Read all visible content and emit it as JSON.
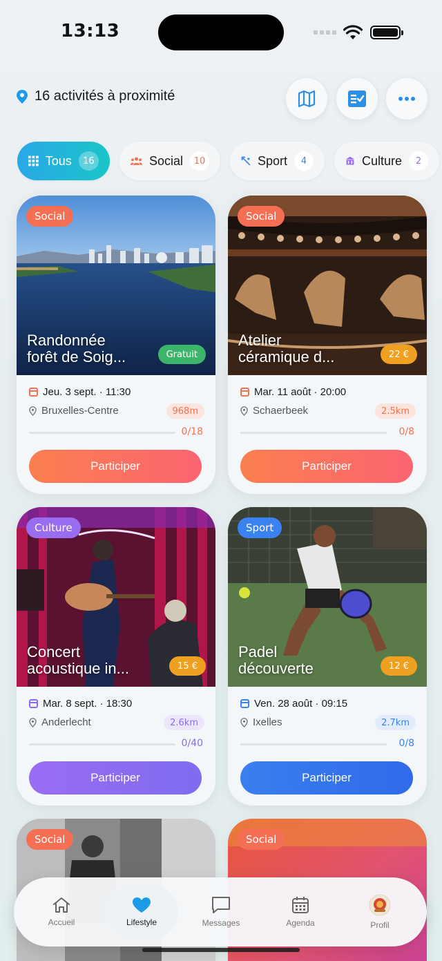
{
  "status_bar": {
    "time": "13:13"
  },
  "header": {
    "location_text": "16 activités à proximité",
    "buttons": [
      {
        "icon": "map-icon"
      },
      {
        "icon": "checklist-icon"
      },
      {
        "icon": "more-icon"
      }
    ]
  },
  "filters": [
    {
      "label": "Tous",
      "count": "16",
      "icon": "grid-icon",
      "active": true
    },
    {
      "label": "Social",
      "count": "10",
      "icon": "people-icon",
      "active": false
    },
    {
      "label": "Sport",
      "count": "4",
      "icon": "sport-icon",
      "active": false
    },
    {
      "label": "Culture",
      "count": "2",
      "icon": "museum-icon",
      "active": false
    }
  ],
  "cards": [
    {
      "category": "Social",
      "title_line1": "Randonnée",
      "title_line2": "forêt de Soig...",
      "price": "Gratuit",
      "date": "Jeu. 3 sept. · 11:30",
      "place": "Bruxelles-Centre",
      "distance": "968m",
      "participants": "0/18",
      "fill": 0,
      "cta": "Participer",
      "accent": "#fb6f53"
    },
    {
      "category": "Social",
      "title_line1": "Atelier",
      "title_line2": "céramique d...",
      "price": "22 €",
      "date": "Mar. 11 août · 20:00",
      "place": "Schaerbeek",
      "distance": "2.5km",
      "participants": "0/8",
      "fill": 0,
      "cta": "Participer",
      "accent": "#fb6f53"
    },
    {
      "category": "Culture",
      "title_line1": "Concert",
      "title_line2": "acoustique in...",
      "price": "15 €",
      "date": "Mar. 8 sept. · 18:30",
      "place": "Anderlecht",
      "distance": "2.6km",
      "participants": "0/40",
      "fill": 0,
      "cta": "Participer",
      "accent": "#8b6cf0"
    },
    {
      "category": "Sport",
      "title_line1": "Padel",
      "title_line2": "découverte",
      "price": "12 €",
      "date": "Ven. 28 août · 09:15",
      "place": "Ixelles",
      "distance": "2.7km",
      "participants": "0/8",
      "fill": 0,
      "cta": "Participer",
      "accent": "#3b7ff1"
    },
    {
      "category": "Social"
    },
    {
      "category": "Social"
    }
  ],
  "colors": {
    "social": "#f56f55",
    "culture": "#9a6df0",
    "sport": "#3b82f1",
    "free": "#3cb56b",
    "price": "#f0a020"
  },
  "nav": [
    {
      "label": "Accueil",
      "icon": "home-icon",
      "active": false
    },
    {
      "label": "Lifestyle",
      "icon": "heart-icon",
      "active": true
    },
    {
      "label": "Messages",
      "icon": "chat-icon",
      "active": false
    },
    {
      "label": "Agenda",
      "icon": "calendar-icon",
      "active": false
    },
    {
      "label": "Profil",
      "icon": "avatar",
      "active": false
    }
  ]
}
